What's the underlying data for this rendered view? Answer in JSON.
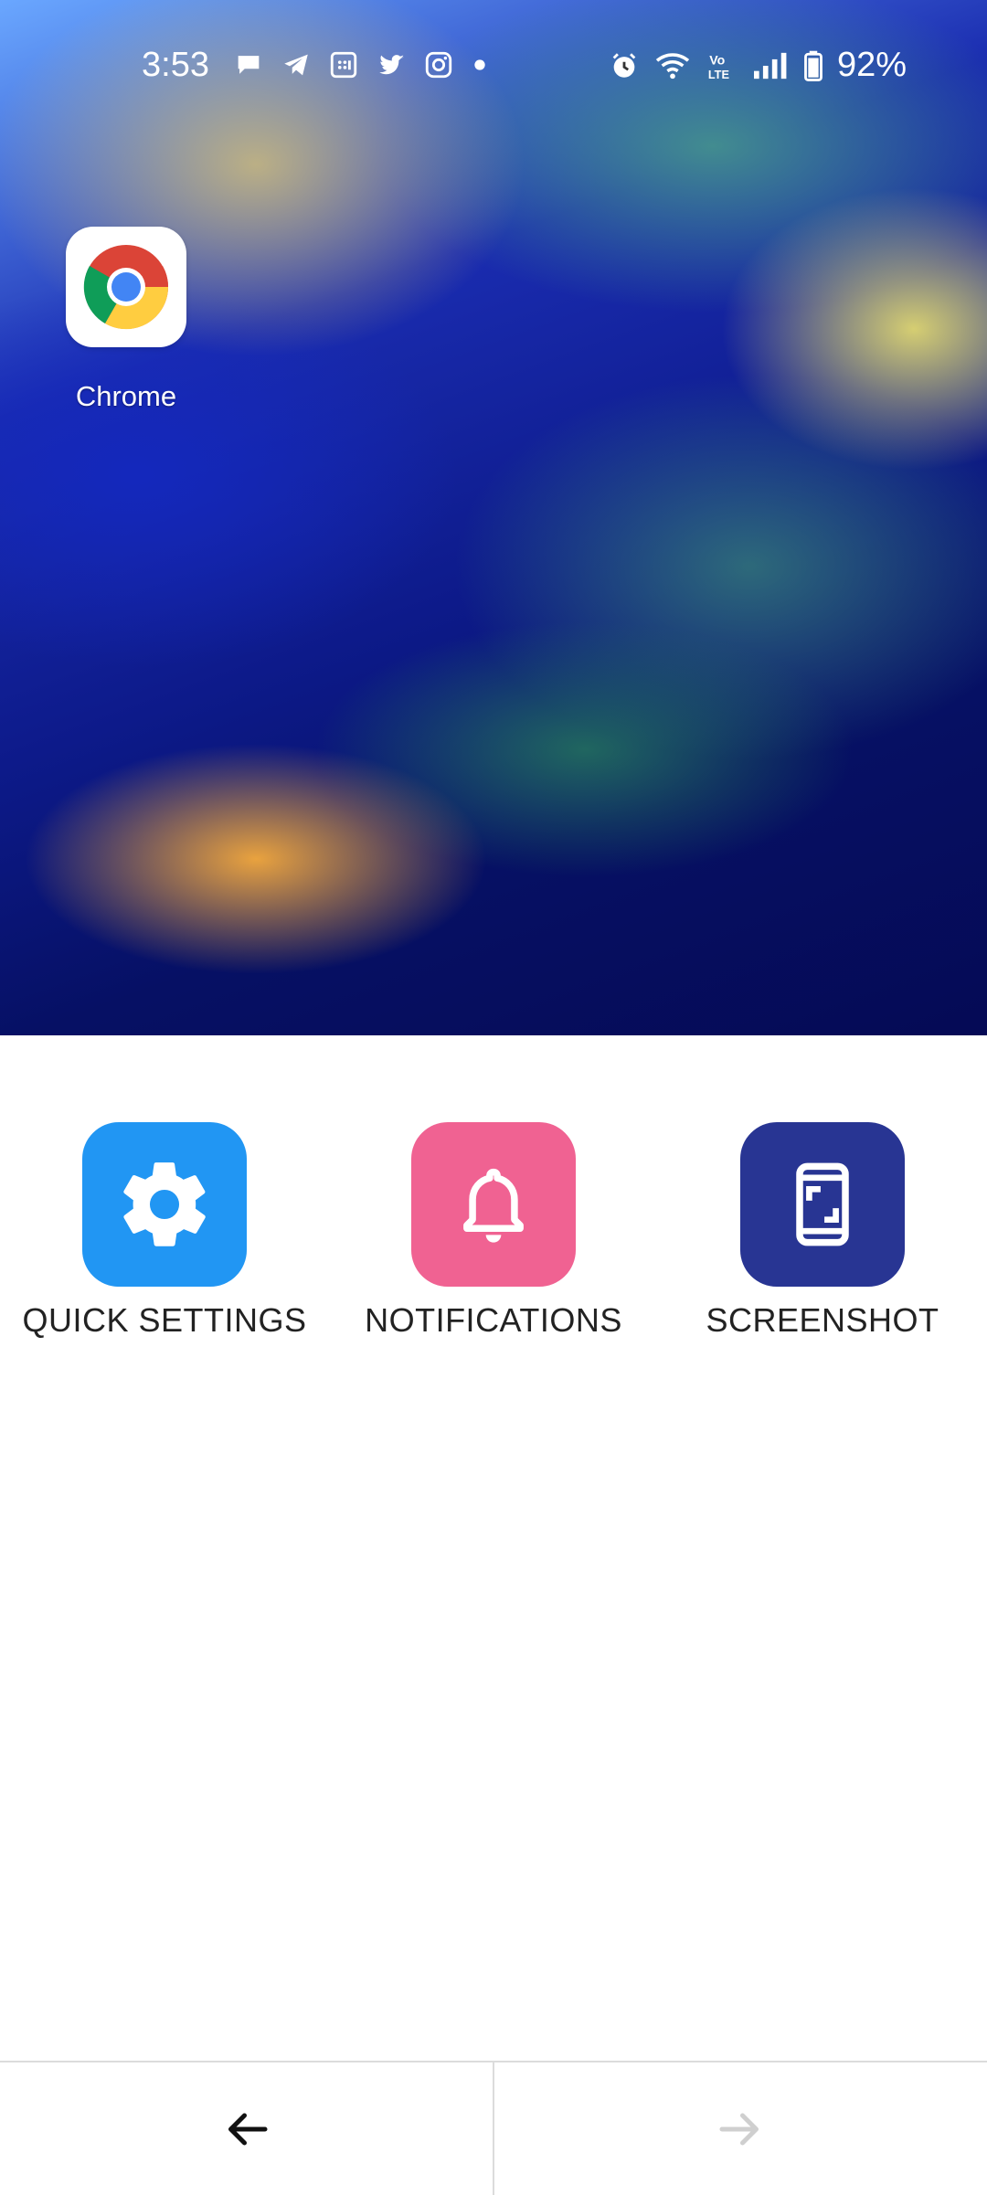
{
  "status_bar": {
    "time": "3:53",
    "left_icons": [
      "message-bubble-icon",
      "telegram-icon",
      "calculator-icon",
      "twitter-icon",
      "instagram-icon",
      "dot-icon"
    ],
    "right_icons": [
      "alarm-icon",
      "wifi-icon",
      "volte-icon",
      "signal-icon",
      "battery-icon"
    ],
    "battery": "92%"
  },
  "home": {
    "app_label": "Chrome",
    "app_icon": "chrome-icon"
  },
  "actions": [
    {
      "label": "QUICK SETTINGS",
      "icon": "gear-icon",
      "color": "#2196f3"
    },
    {
      "label": "NOTIFICATIONS",
      "icon": "bell-icon",
      "color": "#f06292"
    },
    {
      "label": "SCREENSHOT",
      "icon": "phone-screenshot-icon",
      "color": "#283593"
    }
  ],
  "nav": {
    "back_icon": "arrow-left-icon",
    "forward_icon": "arrow-right-icon"
  }
}
